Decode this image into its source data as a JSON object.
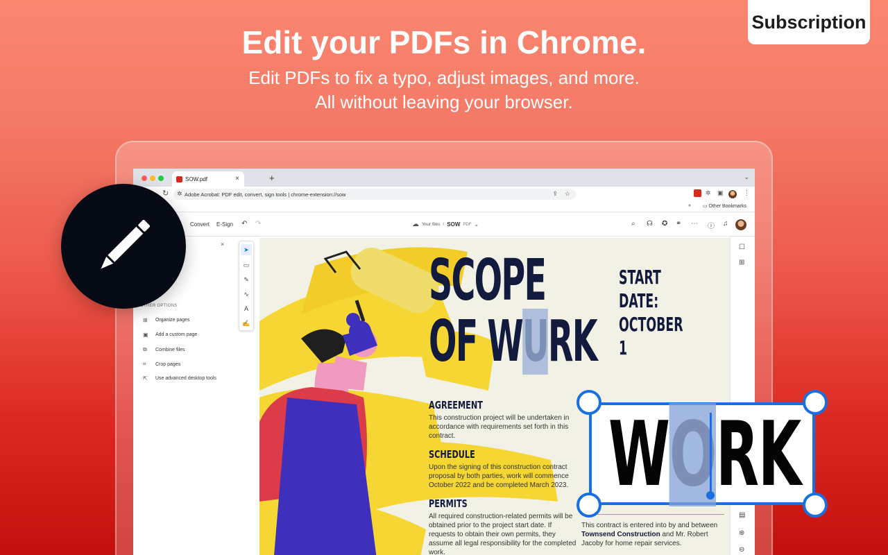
{
  "promo": {
    "badge": "Subscription",
    "headline": "Edit your PDFs in Chrome.",
    "subline1": "Edit PDFs to fix a typo, adjust images, and more.",
    "subline2": "All without leaving your browser."
  },
  "browser": {
    "tab_title": "SOW.pdf",
    "tab_close": "×",
    "new_tab": "+",
    "tab_menu": "⌄",
    "url": "Adobe Acrobat: PDF edit, convert, sign tools | chrome-extension://sow",
    "bookmarks_chevron": "»",
    "bookmarks_folder": "Other Bookmarks"
  },
  "acrobat": {
    "menu_convert": "Convert",
    "menu_esign": "E-Sign",
    "breadcrumb_root": "Your files",
    "breadcrumb_sep": "/",
    "file_name": "SOW",
    "file_type": "PDF",
    "panel_close": "×",
    "panel_section": "OTHER OPTIONS",
    "panel_items": [
      {
        "label": "Organize pages",
        "icon": "organize-pages-icon"
      },
      {
        "label": "Add a custom page",
        "icon": "custom-page-icon"
      },
      {
        "label": "Combine files",
        "icon": "combine-files-icon"
      },
      {
        "label": "Crop pages",
        "icon": "crop-pages-icon"
      },
      {
        "label": "Use advanced desktop tools",
        "icon": "desktop-tools-icon"
      }
    ]
  },
  "document": {
    "title_line1": "SCOPE",
    "title_line2_a": "OF W",
    "title_line2_hl": "U",
    "title_line2_b": "RK",
    "start_date_line1": "START DATE:",
    "start_date_line2": "OCTOBER 1",
    "sections": [
      {
        "heading": "AGREEMENT",
        "body": "This construction project will be undertaken in accordance with requirements set forth in this contract."
      },
      {
        "heading": "SCHEDULE",
        "body": "Upon the signing of this construction contract proposal by both parties, work will commence October 2022 and be completed March 2023."
      },
      {
        "heading": "PERMITS",
        "body": "All required construction-related permits will be obtained prior to the project start date. If requests to obtain their own permits, they assume all legal responsibility for the completed work."
      }
    ],
    "contract_pre": "This contract is entered into by and between ",
    "contract_company": "Townsend Construction",
    "contract_post": " and Mr. Robert Jacoby for home repair services."
  },
  "edit_box": {
    "text_a": "W",
    "text_hl": "O",
    "text_b": "RK"
  },
  "colors": {
    "accent": "#1a6fe0",
    "acrobat_red": "#d7291c",
    "poster_yellow": "#f5d633",
    "text_navy": "#121a3e"
  }
}
